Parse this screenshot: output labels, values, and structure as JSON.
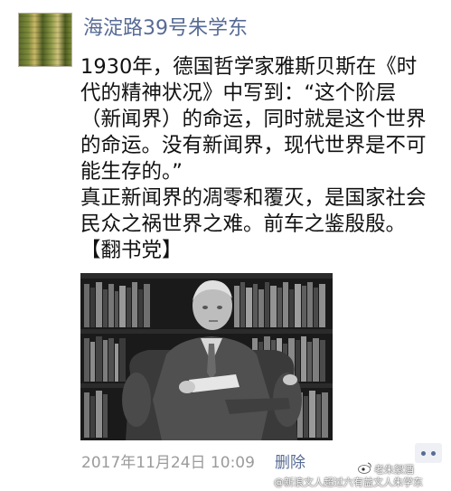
{
  "post": {
    "author": "海淀路39号朱学东",
    "lines": [
      "1930年，德国哲学家雅斯贝斯在《时",
      "代的精神状况》中写到：“这个阶层",
      "（新闻界）的命运，同时就是这个世界",
      "的命运。没有新闻界，现代世界是不可",
      "能生存的。”",
      "真正新闻界的凋零和覆灭，是国家社会",
      "民众之祸世界之难。前车之鉴殷殷。",
      "【翻书党】"
    ],
    "timestamp": "2017年11月24日 10:09",
    "delete_label": "删除"
  },
  "icons": {
    "comment": "comment-icon",
    "weibo": "weibo-logo-icon"
  },
  "colors": {
    "link": "#576b95",
    "meta": "#9b9b9b",
    "text": "#111111"
  },
  "watermark": {
    "name": "老朱絮酒",
    "site": "@新浪文人超过六有益文人朱学东"
  }
}
